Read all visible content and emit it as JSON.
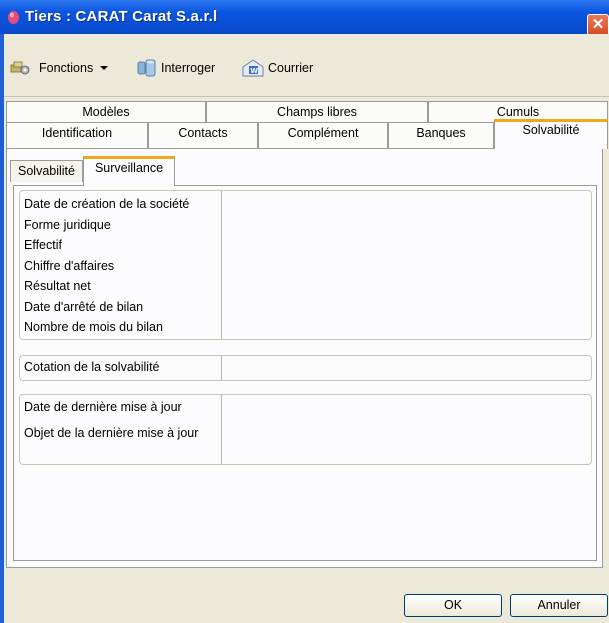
{
  "window": {
    "title": "Tiers : CARAT Carat S.a.r.l",
    "close_glyph": "✕"
  },
  "toolbar": {
    "functions_label": "Fonctions",
    "interroger_label": "Interroger",
    "courrier_label": "Courrier"
  },
  "tabs": {
    "row1": [
      "Modèles",
      "Champs libres",
      "Cumuls"
    ],
    "row2": [
      "Identification",
      "Contacts",
      "Complément",
      "Banques",
      "Solvabilité"
    ],
    "active": "Solvabilité"
  },
  "subtabs": {
    "items": [
      "Solvabilité",
      "Surveillance"
    ],
    "active": "Surveillance"
  },
  "groups": {
    "company": [
      "Date de création de la société",
      "Forme juridique",
      "Effectif",
      "Chiffre d'affaires",
      "Résultat net",
      "Date d'arrêté de bilan",
      "Nombre de mois du bilan"
    ],
    "rating": [
      "Cotation de la solvabilité"
    ],
    "update": [
      "Date de dernière mise à jour",
      "Objet de la dernière mise à jour"
    ]
  },
  "buttons": {
    "ok": "OK",
    "cancel": "Annuler"
  },
  "colors": {
    "titlebar": "#0a4fd6",
    "active_tab_accent": "#f0a81a",
    "dialog_bg": "#ece9d8"
  }
}
